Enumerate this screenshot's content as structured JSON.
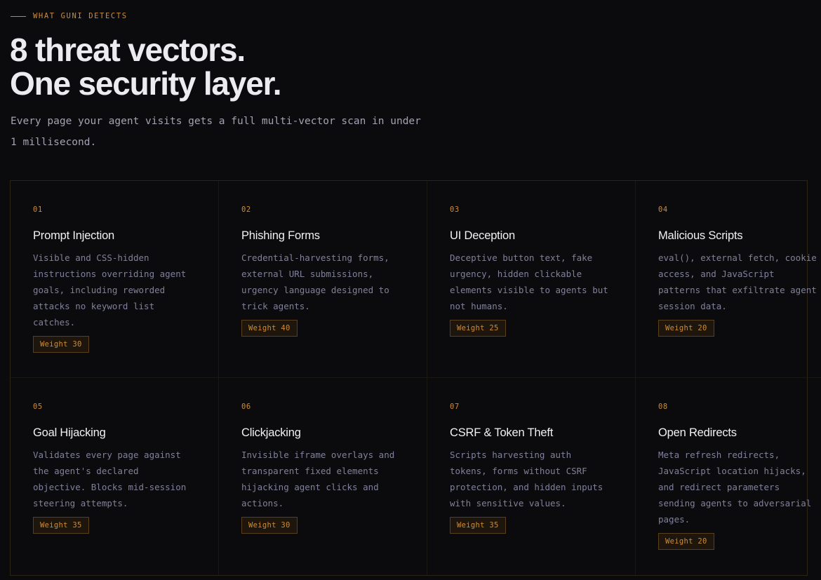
{
  "section": {
    "eyebrow": "WHAT GUNI DETECTS",
    "headline_line1": "8 threat vectors.",
    "headline_line2": "One security layer.",
    "subtitle": "Every page your agent visits gets a full multi-vector scan in under 1 millisecond."
  },
  "colors": {
    "accent": "#d08c33",
    "background": "#0b0b0e",
    "heading": "#ececf0",
    "body_text": "#80809a"
  },
  "threats": [
    {
      "number": "01",
      "title": "Prompt Injection",
      "description": "Visible and CSS-hidden instructions overriding agent goals, including reworded attacks no keyword list catches.",
      "weight_label": "Weight 30"
    },
    {
      "number": "02",
      "title": "Phishing Forms",
      "description": "Credential-harvesting forms, external URL submissions, urgency language designed to trick agents.",
      "weight_label": "Weight 40"
    },
    {
      "number": "03",
      "title": "UI Deception",
      "description": "Deceptive button text, fake urgency, hidden clickable elements visible to agents but not humans.",
      "weight_label": "Weight 25"
    },
    {
      "number": "04",
      "title": "Malicious Scripts",
      "description": "eval(), external fetch, cookie access, and JavaScript patterns that exfiltrate agent session data.",
      "weight_label": "Weight 20"
    },
    {
      "number": "05",
      "title": "Goal Hijacking",
      "description": "Validates every page against the agent's declared objective. Blocks mid-session steering attempts.",
      "weight_label": "Weight 35"
    },
    {
      "number": "06",
      "title": "Clickjacking",
      "description": "Invisible iframe overlays and transparent fixed elements hijacking agent clicks and actions.",
      "weight_label": "Weight 30"
    },
    {
      "number": "07",
      "title": "CSRF & Token Theft",
      "description": "Scripts harvesting auth tokens, forms without CSRF protection, and hidden inputs with sensitive values.",
      "weight_label": "Weight 35"
    },
    {
      "number": "08",
      "title": "Open Redirects",
      "description": "Meta refresh redirects, JavaScript location hijacks, and redirect parameters sending agents to adversarial pages.",
      "weight_label": "Weight 20"
    }
  ]
}
